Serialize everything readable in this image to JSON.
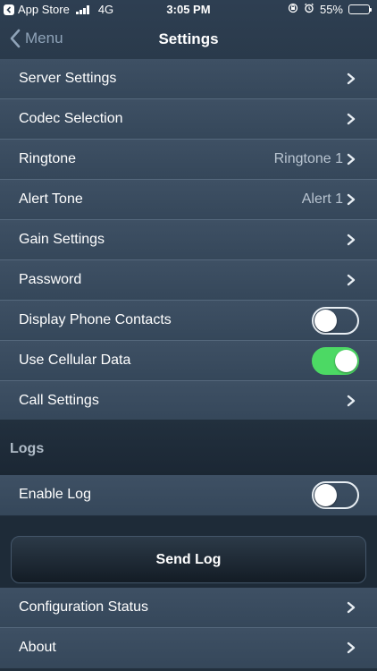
{
  "status_bar": {
    "back_app": "App Store",
    "network": "4G",
    "time": "3:05 PM",
    "battery": "55%",
    "battery_level": 0.55
  },
  "nav": {
    "back_label": "Menu",
    "title": "Settings"
  },
  "settings": {
    "server_settings": "Server Settings",
    "codec_selection": "Codec Selection",
    "ringtone": "Ringtone",
    "ringtone_value": "Ringtone 1",
    "alert_tone": "Alert Tone",
    "alert_tone_value": "Alert 1",
    "gain_settings": "Gain Settings",
    "password": "Password",
    "display_phone_contacts": "Display Phone Contacts",
    "display_phone_contacts_on": false,
    "use_cellular_data": "Use Cellular Data",
    "use_cellular_data_on": true,
    "call_settings": "Call Settings"
  },
  "logs": {
    "header": "Logs",
    "enable_log": "Enable Log",
    "enable_log_on": false,
    "send_log": "Send Log"
  },
  "footer": {
    "configuration_status": "Configuration Status",
    "about": "About"
  },
  "colors": {
    "toggle_on": "#4cd964",
    "battery_fill": "#ffd60a",
    "row_bg": "#3e5064"
  }
}
